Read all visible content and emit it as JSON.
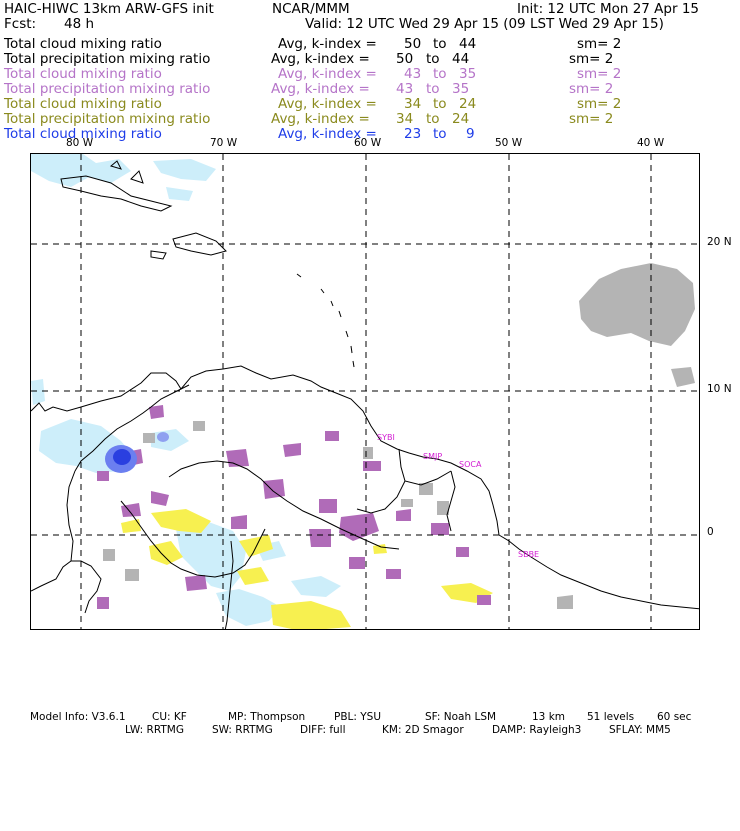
{
  "header": {
    "model_title": "HAIC-HIWC 13km ARW-GFS init",
    "institution": "NCAR/MMM",
    "init_time": "Init: 12 UTC Mon 27 Apr 15",
    "forecast_label": "Fcst:",
    "forecast_hours": "48 h",
    "valid_time": "Valid: 12 UTC Wed 29 Apr 15 (09 LST Wed 29 Apr 15)"
  },
  "fields": [
    {
      "name": "Total cloud mixing ratio",
      "avg": "Avg, k-index =",
      "k_from": "50",
      "to": "to",
      "k_to": "44",
      "sm": "sm= 2",
      "color": "#000000"
    },
    {
      "name": "Total precipitation mixing ratio",
      "avg": "Avg, k-index =",
      "k_from": "50",
      "to": "to",
      "k_to": "44",
      "sm": "sm= 2",
      "color": "#000000"
    },
    {
      "name": "Total cloud mixing ratio",
      "avg": "Avg, k-index =",
      "k_from": "43",
      "to": "to",
      "k_to": "35",
      "sm": "sm= 2",
      "color": "#b574c8"
    },
    {
      "name": "Total precipitation mixing ratio",
      "avg": "Avg, k-index =",
      "k_from": "43",
      "to": "to",
      "k_to": "35",
      "sm": "sm= 2",
      "color": "#b574c8"
    },
    {
      "name": "Total cloud mixing ratio",
      "avg": "Avg, k-index =",
      "k_from": "34",
      "to": "to",
      "k_to": "24",
      "sm": "sm= 2",
      "color": "#8a8a1e"
    },
    {
      "name": "Total precipitation mixing ratio",
      "avg": "Avg, k-index =",
      "k_from": "34",
      "to": "to",
      "k_to": "24",
      "sm": "sm= 2",
      "color": "#8a8a1e"
    },
    {
      "name": "Total cloud mixing ratio",
      "avg": "Avg, k-index =",
      "k_from": "23",
      "to": "to",
      "k_to": "9",
      "sm": "",
      "color": "#1f3ce8"
    }
  ],
  "map": {
    "longitude_labels": [
      "80 W",
      "70 W",
      "60 W",
      "50 W",
      "40 W"
    ],
    "latitude_labels": [
      "20 N",
      "10 N",
      "0"
    ],
    "station_labels": [
      "SYBI",
      "SMJP",
      "SOCA",
      "SBBE"
    ],
    "fill_colors": {
      "low_level_cloud_lightblue": "#cdeefa",
      "mid_level_purple": "#b06bb8",
      "upper_yellow": "#f7f050",
      "high_grey": "#b4b4b4",
      "dense_blue": "#2a3fe0"
    }
  },
  "footer": {
    "line1": {
      "model_info": "Model Info: V3.6.1",
      "cu": "CU: KF",
      "mp": "MP: Thompson",
      "pbl": "PBL: YSU",
      "sf": "SF: Noah LSM",
      "res": "13 km",
      "levels": "51 levels",
      "dt": "60 sec"
    },
    "line2": {
      "lw": "LW: RRTMG",
      "sw": "SW: RRTMG",
      "diff": "DIFF: full",
      "km": "KM: 2D Smagor",
      "damp": "DAMP: Rayleigh3",
      "sflay": "SFLAY: MM5"
    }
  }
}
